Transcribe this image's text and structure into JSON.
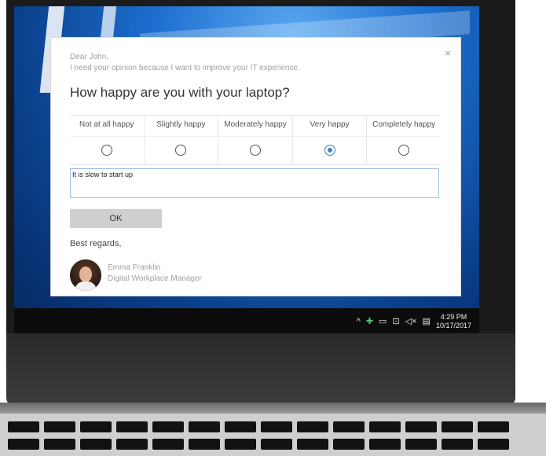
{
  "dialog": {
    "close_icon": "×",
    "greeting_line1": "Dear John,",
    "greeting_line2": "I need your opinion because I want to improve your IT experience.",
    "question": "How happy are you with your laptop?",
    "rating_options": [
      {
        "label": "Not at all happy",
        "selected": false
      },
      {
        "label": "Slightly happy",
        "selected": false
      },
      {
        "label": "Moderately happy",
        "selected": false
      },
      {
        "label": "Very happy",
        "selected": true
      },
      {
        "label": "Completely happy",
        "selected": false
      }
    ],
    "comment_value": "It is slow to start up",
    "ok_label": "OK",
    "regards": "Best regards,",
    "signer_name": "Emma Franklin",
    "signer_title": "Digital Workplace Manager"
  },
  "taskbar": {
    "tray_icons": [
      "chevron-up-icon",
      "app-icon",
      "battery-icon",
      "network-icon",
      "volume-mute-icon",
      "notification-icon"
    ],
    "time": "4:29 PM",
    "date": "10/17/2017"
  },
  "colors": {
    "accent": "#3b82c4",
    "button_bg": "#cfcfcf"
  }
}
